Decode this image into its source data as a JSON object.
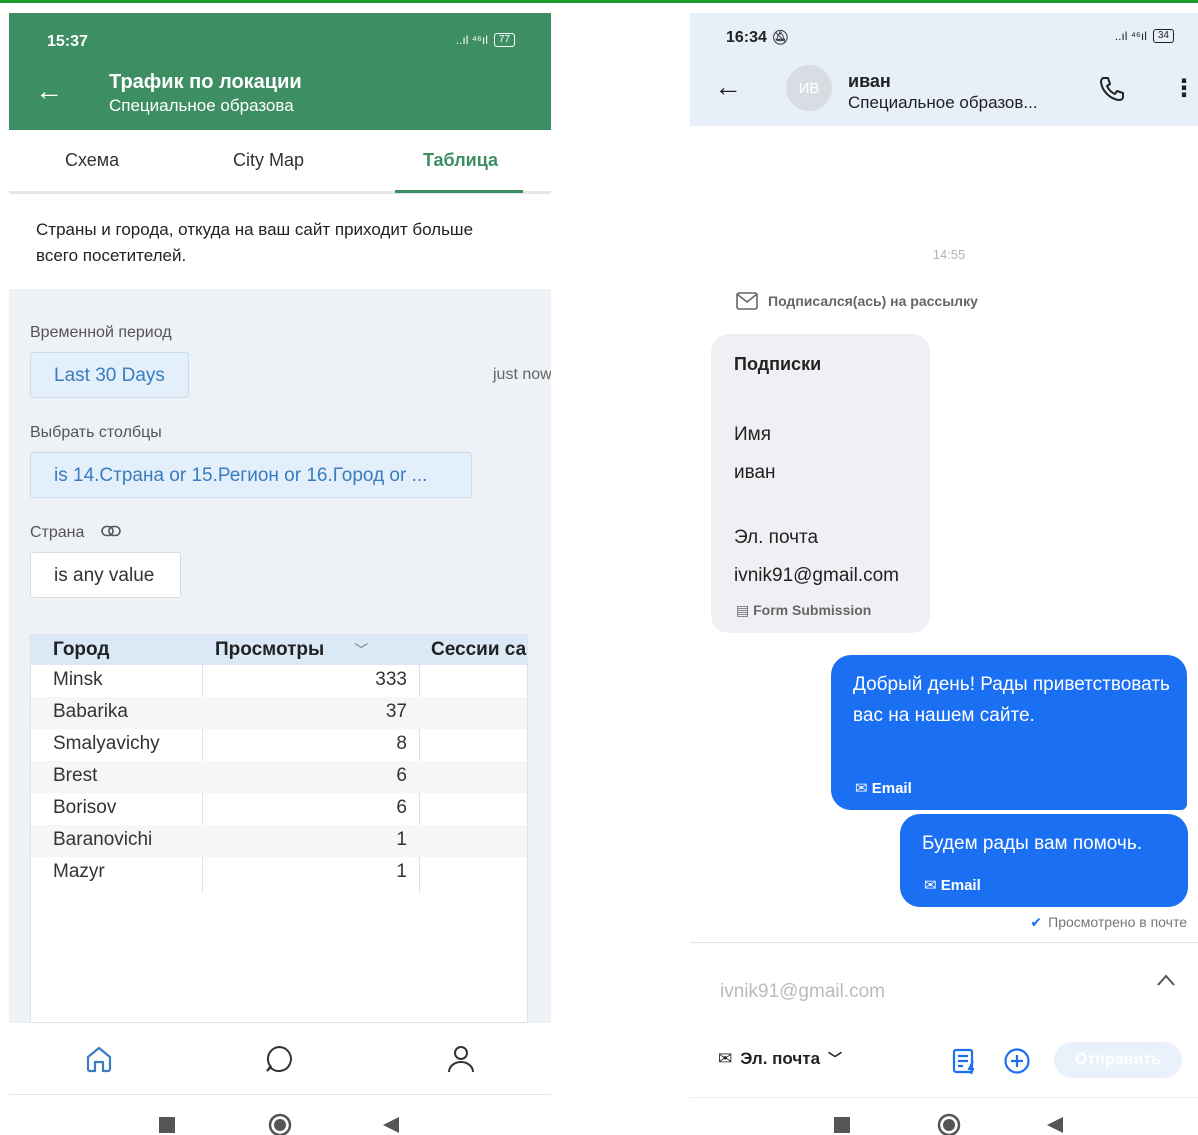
{
  "left": {
    "status": {
      "time": "15:37",
      "network": "..ıl ⁴⁶ıl",
      "battery": "77"
    },
    "header": {
      "title": "Трафик по локации",
      "subtitle": "Специальное образова"
    },
    "tabs": [
      {
        "label": "Схема",
        "active": false
      },
      {
        "label": "City Map",
        "active": false
      },
      {
        "label": "Таблица",
        "active": true
      }
    ],
    "description": "Страны и города, откуда на ваш сайт приходит больше всего посетителей.",
    "filters": {
      "period_label": "Временной период",
      "period_value": "Last 30 Days",
      "updated": "just now",
      "columns_label": "Выбрать столбцы",
      "columns_value": "is 14.Страна or 15.Регион or 16.Город or ...",
      "country_label": "Страна",
      "country_value": "is any value"
    },
    "table": {
      "headers": [
        "Город",
        "Просмотры",
        "Сессии са"
      ],
      "rows": [
        {
          "city": "Minsk",
          "views": "333"
        },
        {
          "city": "Babarika",
          "views": "37"
        },
        {
          "city": "Smalyavichy",
          "views": "8"
        },
        {
          "city": "Brest",
          "views": "6"
        },
        {
          "city": "Borisov",
          "views": "6"
        },
        {
          "city": "Baranovichi",
          "views": "1"
        },
        {
          "city": "Mazyr",
          "views": "1"
        }
      ]
    },
    "accent": "#3e8e63"
  },
  "right": {
    "status": {
      "time": "16:34",
      "network": "..ıl ⁴⁶ıl",
      "battery": "34"
    },
    "header": {
      "avatar": "ИВ",
      "name": "иван",
      "subtitle": "Специальное образов..."
    },
    "timestamp": "14:55",
    "event": "Подписался(ась) на рассылку",
    "card": {
      "title": "Подписки",
      "name_label": "Имя",
      "name_value": "иван",
      "email_label": "Эл. почта",
      "email_value": "ivnik91@gmail.com",
      "source": "Form Submission"
    },
    "messages": [
      {
        "text": "Добрый день! Рады приветствовать вас на нашем сайте.",
        "channel": "Email"
      },
      {
        "text": "Будем рады вам помочь.",
        "channel": "Email"
      }
    ],
    "seen": "Просмотрено в почте",
    "composer": {
      "to": "ivnik91@gmail.com",
      "channel": "Эл. почта",
      "send": "Отправить"
    },
    "accent": "#1a6ff2"
  }
}
